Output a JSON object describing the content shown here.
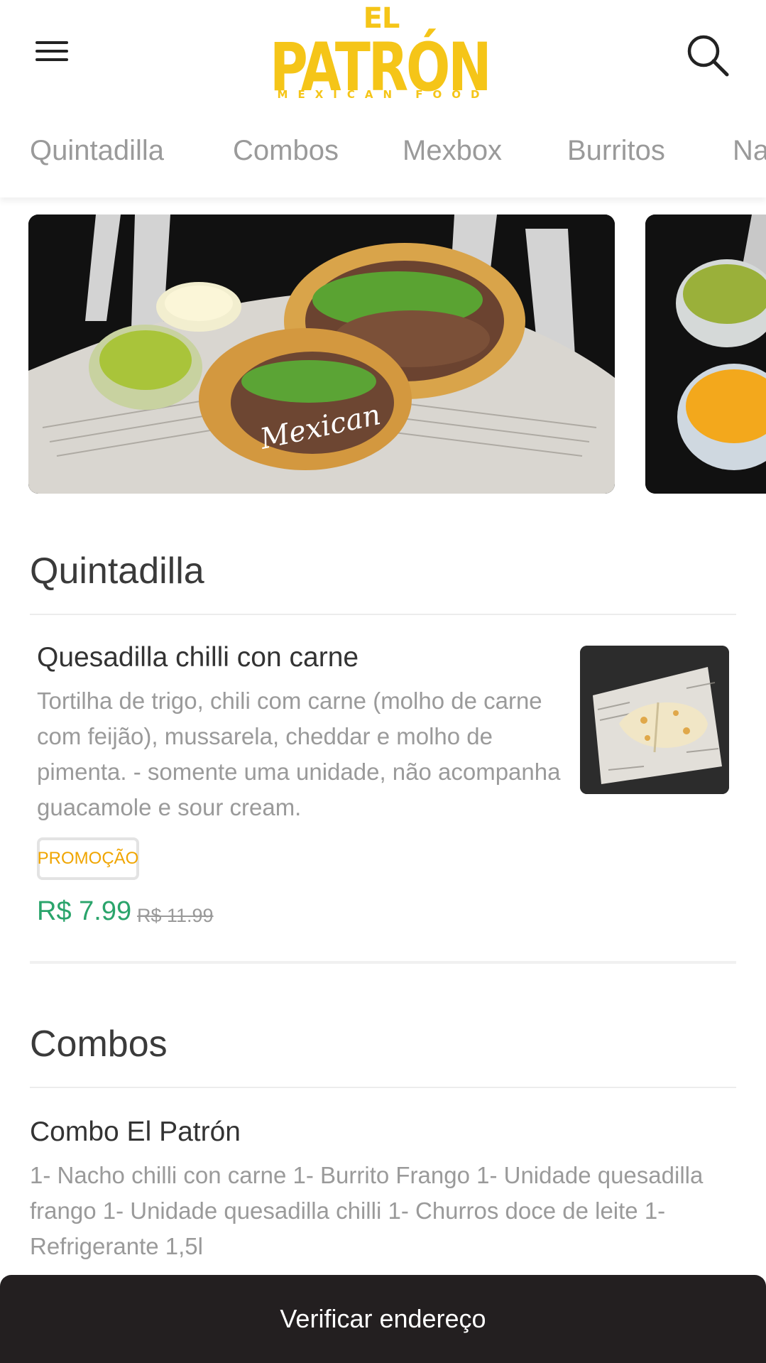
{
  "header": {
    "logo": {
      "prefix": "EL",
      "name": "PATRÓN",
      "subtitle": "MEXICAN FOOD",
      "color": "#f5c518"
    },
    "menu_icon": "hamburger-menu-icon",
    "search_icon": "search-icon"
  },
  "tabs": [
    "Quintadilla",
    "Combos",
    "Mexbox",
    "Burritos",
    "Na"
  ],
  "banners": [
    {
      "alt": "burrito-with-guacamole-banner"
    },
    {
      "alt": "guacamole-and-cheese-sauce-banner"
    }
  ],
  "sections": [
    {
      "title": "Quintadilla",
      "items": [
        {
          "name": "Quesadilla chilli con carne",
          "description": "Tortilha de trigo, chili com carne (molho de carne com feijão), mussarela, cheddar e molho de pimenta. - somente uma unidade, não acompanha guacamole e sour cream.",
          "badge": "PROMOÇÃO",
          "price": "R$ 7.99",
          "old_price": "R$ 11.99"
        }
      ]
    },
    {
      "title": "Combos",
      "items": [
        {
          "name": "Combo El Patrón",
          "description": "1- Nacho chilli con carne 1- Burrito Frango 1- Unidade quesadilla frango 1- Unidade quesadilla chilli 1- Churros doce de leite 1- Refrigerante 1,5l"
        }
      ]
    }
  ],
  "bottom_bar": {
    "label": "Verificar endereço"
  },
  "colors": {
    "brand_yellow": "#f5c518",
    "price_green": "#2aa46b",
    "badge_orange": "#f0a500",
    "bottom_bar_bg": "#231f20"
  }
}
